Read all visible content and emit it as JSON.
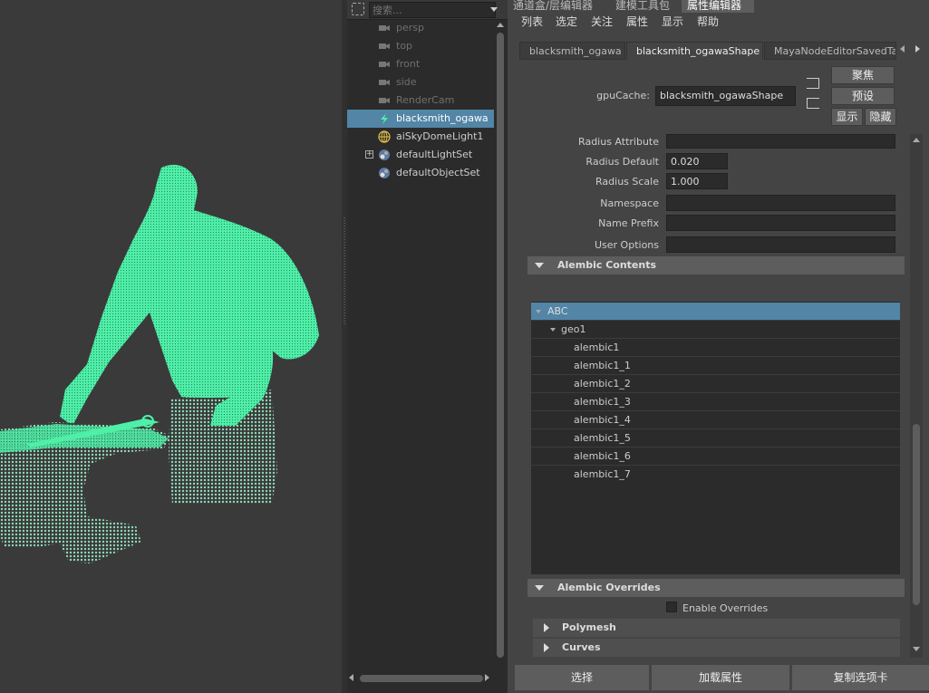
{
  "outliner": {
    "search_placeholder": "搜索...",
    "items": [
      {
        "label": "persp"
      },
      {
        "label": "top"
      },
      {
        "label": "front"
      },
      {
        "label": "side"
      },
      {
        "label": "RenderCam"
      },
      {
        "label": "blacksmith_ogawa"
      },
      {
        "label": "aiSkyDomeLight1"
      },
      {
        "label": "defaultLightSet"
      },
      {
        "label": "defaultObjectSet"
      }
    ]
  },
  "top_tabs": [
    "通道盒/层编辑器",
    "建模工具包",
    "属性编辑器"
  ],
  "menu": [
    "列表",
    "选定",
    "关注",
    "属性",
    "显示",
    "帮助"
  ],
  "node_tabs": [
    "blacksmith_ogawa",
    "blacksmith_ogawaShape",
    "MayaNodeEditorSavedTab"
  ],
  "node": {
    "type_label": "gpuCache:",
    "name": "blacksmith_ogawaShape"
  },
  "side_buttons": {
    "focus": "聚焦",
    "presets": "预设",
    "show": "显示",
    "hide": "隐藏"
  },
  "attrs": {
    "radius_attribute": {
      "label": "Radius Attribute",
      "value": ""
    },
    "radius_default": {
      "label": "Radius Default",
      "value": "0.020"
    },
    "radius_scale": {
      "label": "Radius Scale",
      "value": "1.000"
    },
    "namespace": {
      "label": "Namespace",
      "value": ""
    },
    "name_prefix": {
      "label": "Name Prefix",
      "value": ""
    },
    "user_options": {
      "label": "User Options",
      "value": ""
    }
  },
  "sections": {
    "contents": "Alembic Contents",
    "overrides": "Alembic Overrides",
    "polymesh": "Polymesh",
    "curves": "Curves"
  },
  "tree": {
    "root": "ABC",
    "group": "geo1",
    "children": [
      "alembic1",
      "alembic1_1",
      "alembic1_2",
      "alembic1_3",
      "alembic1_4",
      "alembic1_5",
      "alembic1_6",
      "alembic1_7"
    ]
  },
  "enable_overrides": {
    "label": "Enable Overrides",
    "checked": false
  },
  "bottom_buttons": [
    "选择",
    "加载属性",
    "复制选项卡"
  ],
  "colors": {
    "selection": "#5285a6",
    "pointcloud": "#4ef0a8",
    "panel": "#444444"
  }
}
